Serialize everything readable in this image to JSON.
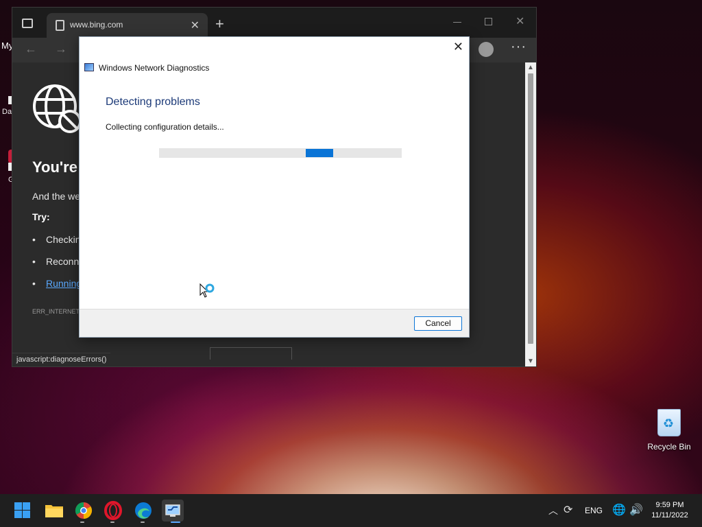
{
  "desktop": {
    "left_label": "My",
    "left_label2": "Da",
    "left_label3": "G",
    "recycle_bin_label": "Recycle Bin"
  },
  "browser": {
    "tab_title": "www.bing.com",
    "tab_close": "✕",
    "new_tab": "+",
    "back": "←",
    "forward": "→",
    "menu": "···",
    "window_close": "✕",
    "content": {
      "heading": "You're",
      "text": "And the we",
      "try_label": "Try:",
      "bullets": [
        "Checkin",
        "Reconne",
        "Running"
      ],
      "error_code": "ERR_INTERNET",
      "status_url": "javascript:diagnoseErrors()"
    }
  },
  "dialog": {
    "close": "✕",
    "title": "Windows Network Diagnostics",
    "heading": "Detecting problems",
    "status": "Collecting configuration details...",
    "progress_indeterminate_position": 0.68,
    "cancel_label": "Cancel"
  },
  "taskbar": {
    "tray_chevron": "︿",
    "language": "ENG",
    "time": "9:59 PM",
    "date": "11/11/2022"
  },
  "colors": {
    "accent": "#0a74d6",
    "dialog_heading": "#1c3a78",
    "link": "#5aa9ff"
  }
}
